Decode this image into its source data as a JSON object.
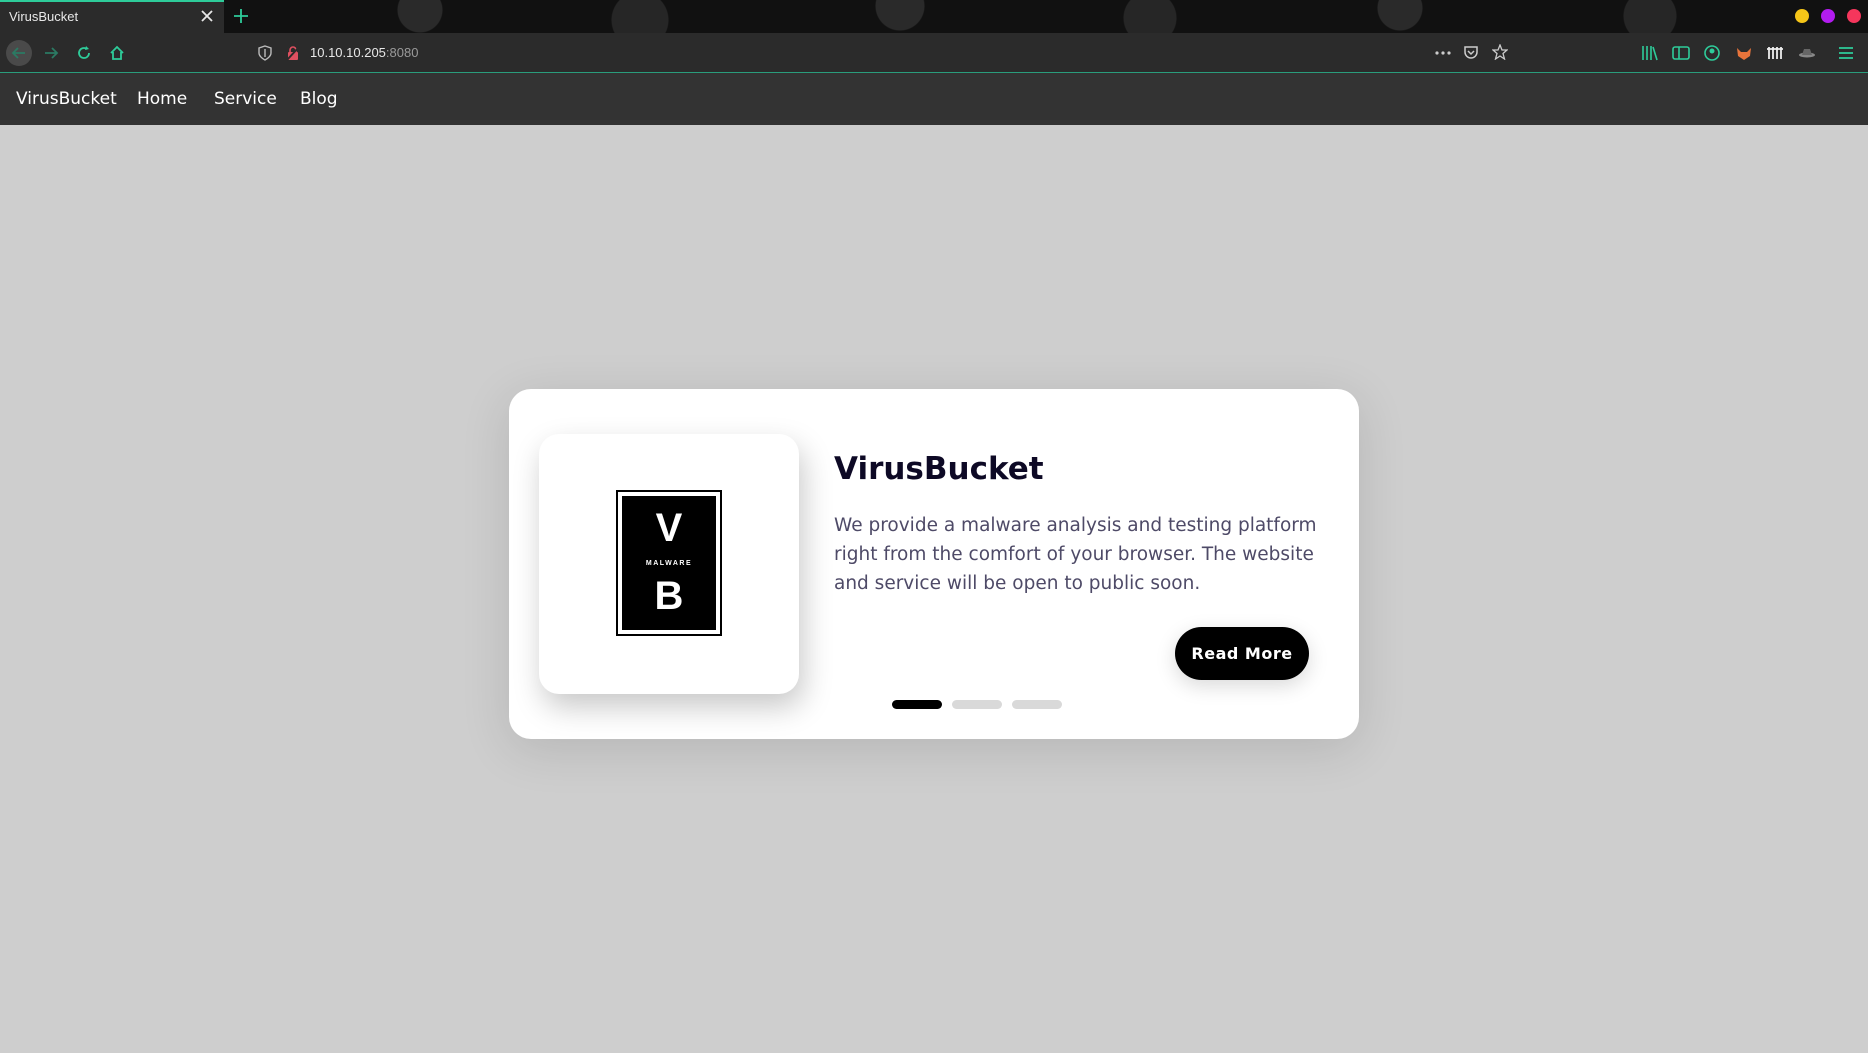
{
  "browser": {
    "tab_title": "VirusBucket",
    "url_host": "10.10.10.205",
    "url_port": ":8080",
    "window_controls": {
      "minimize_color": "#f5c518",
      "maximize_color": "#b31cf0",
      "close_color": "#f5365c"
    },
    "accent_color": "#2ecc9a"
  },
  "site_nav": {
    "brand": "VirusBucket",
    "items": [
      {
        "label": "Home"
      },
      {
        "label": "Service"
      },
      {
        "label": "Blog"
      }
    ]
  },
  "card": {
    "logo": {
      "top": "V",
      "middle": "MALWARE",
      "bottom": "B"
    },
    "title": "VirusBucket",
    "text": "We provide a malware analysis and testing platform right from the comfort of your browser. The website and service will be open to public soon.",
    "button_label": "Read More",
    "slides": {
      "count": 3,
      "active_index": 0
    }
  }
}
